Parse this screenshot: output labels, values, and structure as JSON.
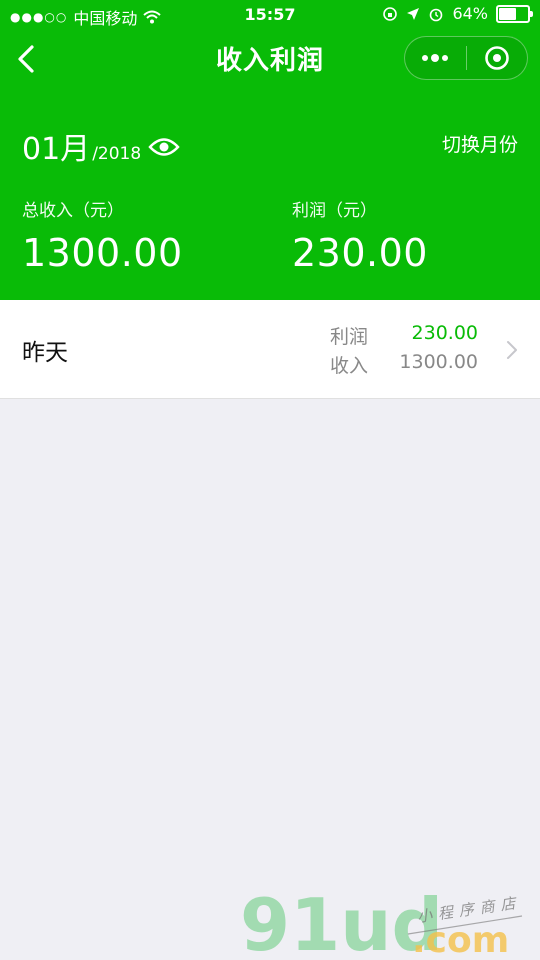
{
  "status_bar": {
    "carrier": "中国移动",
    "time": "15:57",
    "battery": "64%",
    "battery_level": 0.64
  },
  "nav": {
    "title": "收入利润"
  },
  "summary": {
    "month": "01月",
    "year": "/2018",
    "switch_label": "切换月份",
    "income_label": "总收入（元）",
    "income_value": "1300.00",
    "profit_label": "利润（元）",
    "profit_value": "230.00"
  },
  "list": {
    "items": [
      {
        "title": "昨天",
        "profit_label": "利润",
        "profit_value": "230.00",
        "income_label": "收入",
        "income_value": "1300.00"
      }
    ]
  },
  "watermark": {
    "logo": "91ud",
    "domain": ".com",
    "tagline": "小程序商店"
  },
  "colors": {
    "brand_green": "#09bb07",
    "background": "#efeff4"
  }
}
